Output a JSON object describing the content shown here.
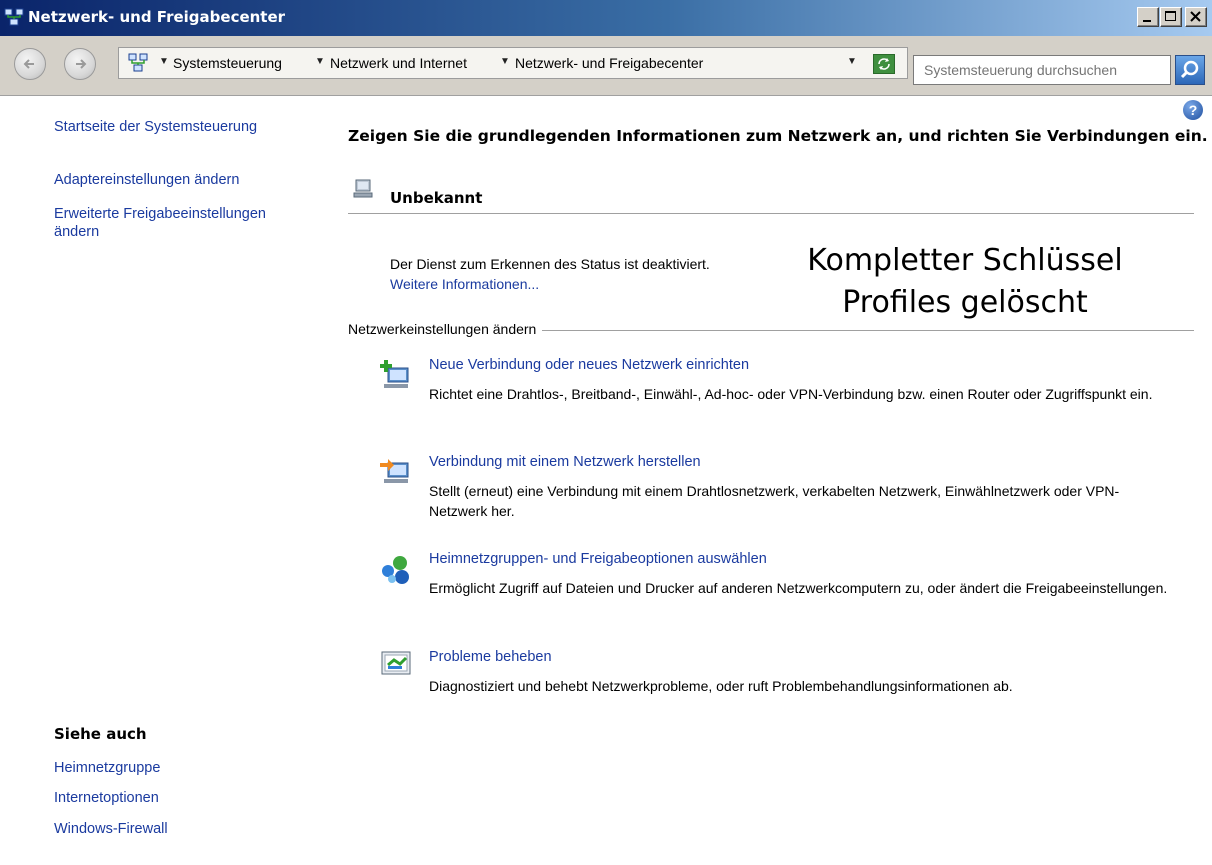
{
  "window": {
    "title": "Netzwerk- und Freigabecenter",
    "controls": [
      "minimize",
      "maximize",
      "close"
    ]
  },
  "address_bar": {
    "breadcrumbs": [
      "Systemsteuerung",
      "Netzwerk und Internet",
      "Netzwerk- und Freigabecenter"
    ],
    "search_placeholder": "Systemsteuerung durchsuchen"
  },
  "sidebar": {
    "home_link": "Startseite der Systemsteuerung",
    "links": [
      "Adaptereinstellungen ändern",
      "Erweiterte Freigabeeinstellungen ändern"
    ],
    "see_also_heading": "Siehe auch",
    "see_also": [
      "Heimnetzgruppe",
      "Internetoptionen",
      "Windows-Firewall"
    ]
  },
  "main": {
    "heading": "Zeigen Sie die grundlegenden Informationen zum Netzwerk an, und richten Sie Verbindungen ein.",
    "network_name": "Unbekannt",
    "status_text": "Der Dienst zum Erkennen des Status ist deaktiviert.",
    "more_info_link": "Weitere Informationen...",
    "annotation": [
      "Kompletter Schlüssel",
      "Profiles gelöscht"
    ],
    "section_label": "Netzwerkeinstellungen ändern",
    "tasks": [
      {
        "title": "Neue Verbindung oder neues Netzwerk einrichten",
        "description": "Richtet eine Drahtlos-, Breitband-, Einwähl-, Ad-hoc- oder VPN-Verbindung bzw. einen Router oder Zugriffspunkt ein.",
        "icon": "new-connection-icon"
      },
      {
        "title": "Verbindung mit einem Netzwerk herstellen",
        "description": "Stellt (erneut) eine Verbindung mit einem Drahtlosnetzwerk, verkabelten Netzwerk, Einwählnetzwerk oder VPN-Netzwerk her.",
        "icon": "connect-network-icon"
      },
      {
        "title": "Heimnetzgruppen- und Freigabeoptionen auswählen",
        "description": "Ermöglicht Zugriff auf Dateien und Drucker auf anderen Netzwerkcomputern zu, oder ändert die Freigabeeinstellungen.",
        "icon": "homegroup-icon"
      },
      {
        "title": "Probleme beheben",
        "description": "Diagnostiziert und behebt Netzwerkprobleme, oder ruft Problembehandlungsinformationen ab.",
        "icon": "troubleshoot-icon"
      }
    ]
  },
  "colors": {
    "link": "#1a3a9f",
    "titlebar_start": "#0a246a",
    "titlebar_end": "#a6caf0",
    "chrome": "#d4d0c8"
  }
}
